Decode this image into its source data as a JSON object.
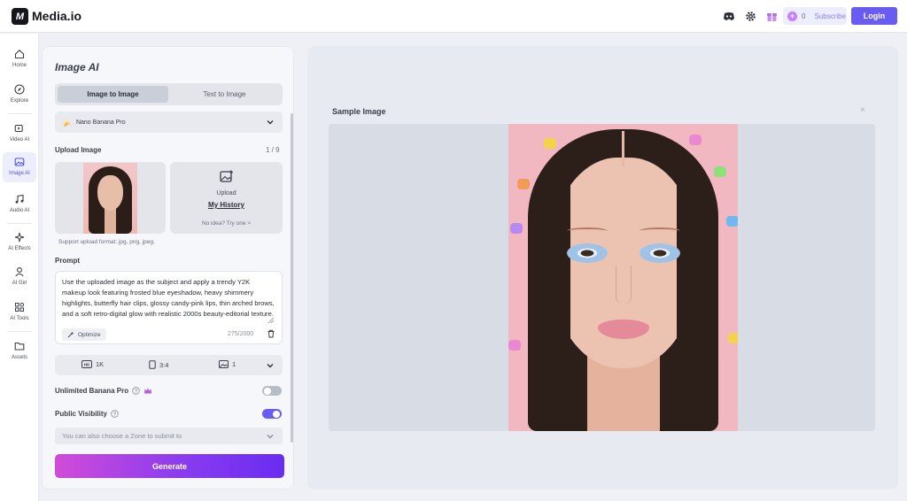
{
  "header": {
    "brand": "Media.io",
    "logo_letter": "M",
    "icons": [
      "discord-icon",
      "gear-icon",
      "gift-icon"
    ],
    "credits_count": "0",
    "subscribe_label": "Subscribe",
    "login_label": "Login"
  },
  "sidebar": {
    "items": [
      {
        "label": "Home",
        "icon": "home-icon"
      },
      {
        "label": "Explore",
        "icon": "compass-icon"
      },
      {
        "label": "Video AI",
        "icon": "video-icon"
      },
      {
        "label": "Image AI",
        "icon": "image-icon",
        "active": true
      },
      {
        "label": "Audio AI",
        "icon": "music-icon"
      },
      {
        "label": "AI Effects",
        "icon": "sparkle-icon"
      },
      {
        "label": "AI Girl",
        "icon": "person-icon"
      },
      {
        "label": "AI Tools",
        "icon": "grid-icon"
      },
      {
        "label": "Assets",
        "icon": "folder-icon"
      }
    ]
  },
  "panel": {
    "title": "Image AI",
    "tabs": [
      "Image to Image",
      "Text to Image"
    ],
    "active_tab": "Image to Image",
    "model": "Nano Banana Pro",
    "upload_label": "Upload Image",
    "upload_count": "1 / 9",
    "upload_button": "Upload",
    "history_link": "My History",
    "idea_link": "No idea? Try one >",
    "support_text": "Support upload format: jpg, png, jpeg.",
    "prompt_label": "Prompt",
    "prompt_text": "Use the uploaded image as the subject and apply a trendy Y2K makeup look featuring frosted blue eyeshadow, heavy shimmery highlights, butterfly hair clips, glossy candy-pink lips, thin arched brows, and a soft retro-digital glow with realistic 2000s beauty-editorial texture.",
    "optimize_label": "Optimize",
    "char_count": "275/2000",
    "resolution": "1K",
    "aspect_ratio": "3:4",
    "image_count": "1",
    "unlimited_label": "Unlimited Banana Pro",
    "unlimited_on": false,
    "visibility_label": "Public Visibility",
    "visibility_on": true,
    "zone_placeholder": "You can also choose a Zone to submit to",
    "generate_label": "Generate"
  },
  "preview": {
    "title": "Sample Image",
    "close_glyph": "×"
  },
  "colors": {
    "accent": "#6a5cf3",
    "generate_start": "#d14bd8",
    "generate_end": "#6a2cf0",
    "toggle_on": "#6a5cf3",
    "toggle_off": "#b8bcc6"
  }
}
